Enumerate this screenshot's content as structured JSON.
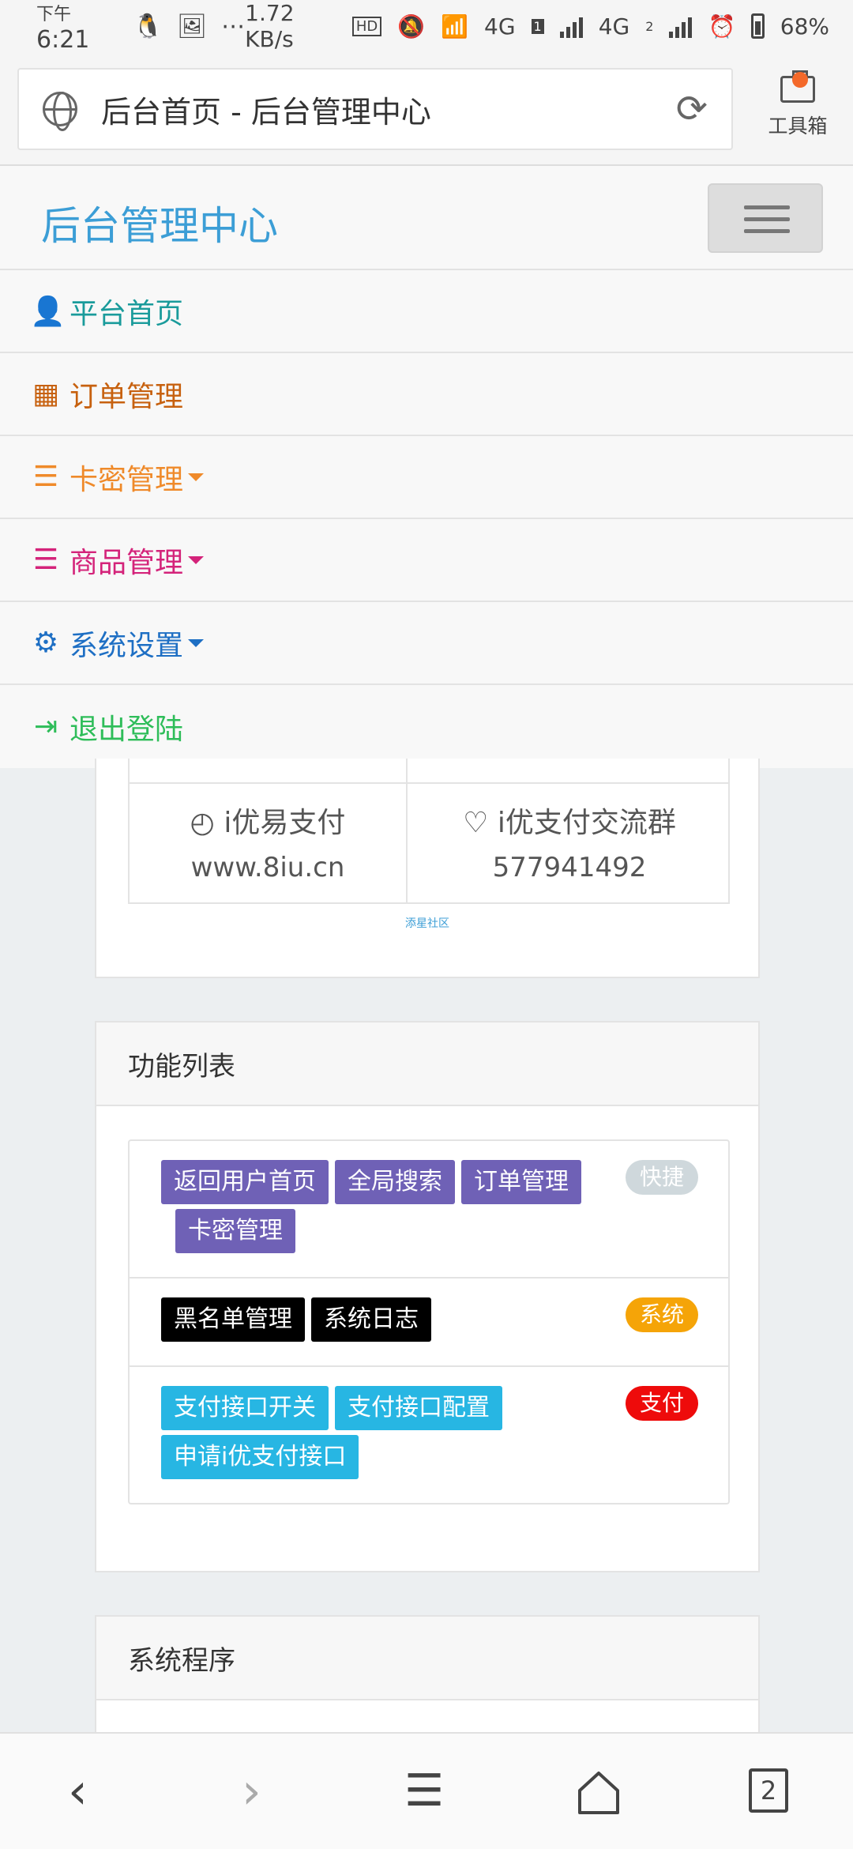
{
  "status_bar": {
    "time_prefix": "下午",
    "time": "6:21",
    "net_speed": "1.72 KB/s",
    "hd_badge": "HD",
    "net1": "4G",
    "sim1": "1",
    "net2": "4G",
    "sim2": "2",
    "battery": "68%"
  },
  "browser": {
    "page_title": "后台首页 - 后台管理中心",
    "toolbox_label": "工具箱"
  },
  "navbar": {
    "brand": "后台管理中心"
  },
  "menu": {
    "items": [
      {
        "label": "平台首页",
        "color": "#1a9b9b",
        "icon": "user-icon"
      },
      {
        "label": "订单管理",
        "color": "#c7610f",
        "icon": "calendar-icon"
      },
      {
        "label": "卡密管理",
        "color": "#ef8a2a",
        "icon": "list-icon"
      },
      {
        "label": "商品管理",
        "color": "#d4237a",
        "icon": "list-icon"
      },
      {
        "label": "系统设置",
        "color": "#1e6fc4",
        "icon": "gear-icon"
      },
      {
        "label": "退出登陆",
        "color": "#2ebd59",
        "icon": "logout-icon"
      }
    ]
  },
  "sponsor": {
    "left_name": "i优易支付",
    "left_value": "www.8iu.cn",
    "right_name": "i优支付交流群",
    "right_value": "577941492",
    "tiny_link": "添星社区"
  },
  "functions": {
    "title": "功能列表",
    "rows": [
      {
        "badge": "快捷",
        "badge_color": "#cfd8dc",
        "buttons": [
          "返回用户首页",
          "全局搜索",
          "订单管理",
          "卡密管理"
        ]
      },
      {
        "badge": "系统",
        "badge_color": "#f5a408",
        "buttons": [
          "黑名单管理",
          "系统日志"
        ]
      },
      {
        "badge": "支付",
        "badge_color": "#ee0b0b",
        "buttons": [
          "支付接口开关",
          "支付接口配置",
          "申请i优支付接口"
        ]
      }
    ]
  },
  "program": {
    "title": "系统程序"
  },
  "bottom_nav": {
    "tab_count": "2"
  }
}
